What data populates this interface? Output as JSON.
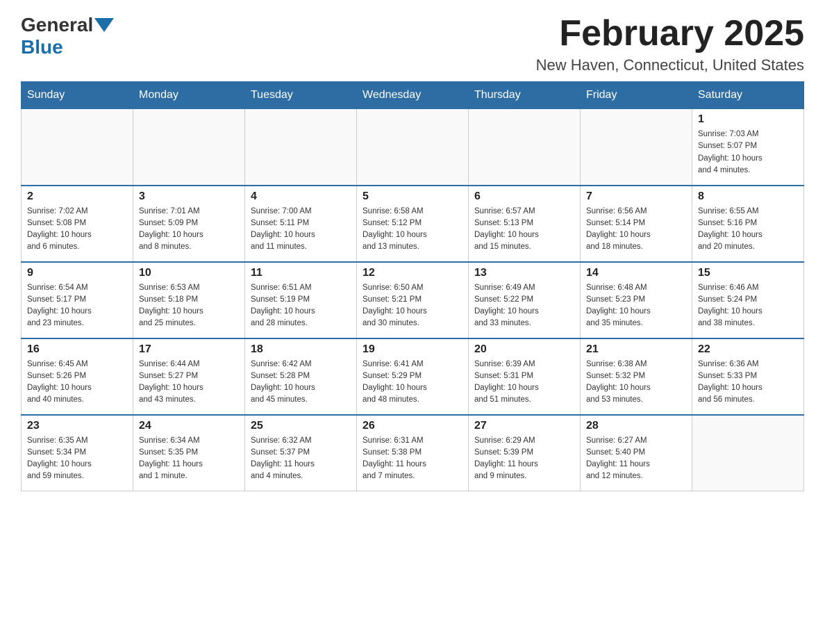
{
  "header": {
    "logo_general": "General",
    "logo_blue": "Blue",
    "month_title": "February 2025",
    "location": "New Haven, Connecticut, United States"
  },
  "weekdays": [
    "Sunday",
    "Monday",
    "Tuesday",
    "Wednesday",
    "Thursday",
    "Friday",
    "Saturday"
  ],
  "weeks": [
    [
      {
        "day": "",
        "info": ""
      },
      {
        "day": "",
        "info": ""
      },
      {
        "day": "",
        "info": ""
      },
      {
        "day": "",
        "info": ""
      },
      {
        "day": "",
        "info": ""
      },
      {
        "day": "",
        "info": ""
      },
      {
        "day": "1",
        "info": "Sunrise: 7:03 AM\nSunset: 5:07 PM\nDaylight: 10 hours\nand 4 minutes."
      }
    ],
    [
      {
        "day": "2",
        "info": "Sunrise: 7:02 AM\nSunset: 5:08 PM\nDaylight: 10 hours\nand 6 minutes."
      },
      {
        "day": "3",
        "info": "Sunrise: 7:01 AM\nSunset: 5:09 PM\nDaylight: 10 hours\nand 8 minutes."
      },
      {
        "day": "4",
        "info": "Sunrise: 7:00 AM\nSunset: 5:11 PM\nDaylight: 10 hours\nand 11 minutes."
      },
      {
        "day": "5",
        "info": "Sunrise: 6:58 AM\nSunset: 5:12 PM\nDaylight: 10 hours\nand 13 minutes."
      },
      {
        "day": "6",
        "info": "Sunrise: 6:57 AM\nSunset: 5:13 PM\nDaylight: 10 hours\nand 15 minutes."
      },
      {
        "day": "7",
        "info": "Sunrise: 6:56 AM\nSunset: 5:14 PM\nDaylight: 10 hours\nand 18 minutes."
      },
      {
        "day": "8",
        "info": "Sunrise: 6:55 AM\nSunset: 5:16 PM\nDaylight: 10 hours\nand 20 minutes."
      }
    ],
    [
      {
        "day": "9",
        "info": "Sunrise: 6:54 AM\nSunset: 5:17 PM\nDaylight: 10 hours\nand 23 minutes."
      },
      {
        "day": "10",
        "info": "Sunrise: 6:53 AM\nSunset: 5:18 PM\nDaylight: 10 hours\nand 25 minutes."
      },
      {
        "day": "11",
        "info": "Sunrise: 6:51 AM\nSunset: 5:19 PM\nDaylight: 10 hours\nand 28 minutes."
      },
      {
        "day": "12",
        "info": "Sunrise: 6:50 AM\nSunset: 5:21 PM\nDaylight: 10 hours\nand 30 minutes."
      },
      {
        "day": "13",
        "info": "Sunrise: 6:49 AM\nSunset: 5:22 PM\nDaylight: 10 hours\nand 33 minutes."
      },
      {
        "day": "14",
        "info": "Sunrise: 6:48 AM\nSunset: 5:23 PM\nDaylight: 10 hours\nand 35 minutes."
      },
      {
        "day": "15",
        "info": "Sunrise: 6:46 AM\nSunset: 5:24 PM\nDaylight: 10 hours\nand 38 minutes."
      }
    ],
    [
      {
        "day": "16",
        "info": "Sunrise: 6:45 AM\nSunset: 5:26 PM\nDaylight: 10 hours\nand 40 minutes."
      },
      {
        "day": "17",
        "info": "Sunrise: 6:44 AM\nSunset: 5:27 PM\nDaylight: 10 hours\nand 43 minutes."
      },
      {
        "day": "18",
        "info": "Sunrise: 6:42 AM\nSunset: 5:28 PM\nDaylight: 10 hours\nand 45 minutes."
      },
      {
        "day": "19",
        "info": "Sunrise: 6:41 AM\nSunset: 5:29 PM\nDaylight: 10 hours\nand 48 minutes."
      },
      {
        "day": "20",
        "info": "Sunrise: 6:39 AM\nSunset: 5:31 PM\nDaylight: 10 hours\nand 51 minutes."
      },
      {
        "day": "21",
        "info": "Sunrise: 6:38 AM\nSunset: 5:32 PM\nDaylight: 10 hours\nand 53 minutes."
      },
      {
        "day": "22",
        "info": "Sunrise: 6:36 AM\nSunset: 5:33 PM\nDaylight: 10 hours\nand 56 minutes."
      }
    ],
    [
      {
        "day": "23",
        "info": "Sunrise: 6:35 AM\nSunset: 5:34 PM\nDaylight: 10 hours\nand 59 minutes."
      },
      {
        "day": "24",
        "info": "Sunrise: 6:34 AM\nSunset: 5:35 PM\nDaylight: 11 hours\nand 1 minute."
      },
      {
        "day": "25",
        "info": "Sunrise: 6:32 AM\nSunset: 5:37 PM\nDaylight: 11 hours\nand 4 minutes."
      },
      {
        "day": "26",
        "info": "Sunrise: 6:31 AM\nSunset: 5:38 PM\nDaylight: 11 hours\nand 7 minutes."
      },
      {
        "day": "27",
        "info": "Sunrise: 6:29 AM\nSunset: 5:39 PM\nDaylight: 11 hours\nand 9 minutes."
      },
      {
        "day": "28",
        "info": "Sunrise: 6:27 AM\nSunset: 5:40 PM\nDaylight: 11 hours\nand 12 minutes."
      },
      {
        "day": "",
        "info": ""
      }
    ]
  ]
}
